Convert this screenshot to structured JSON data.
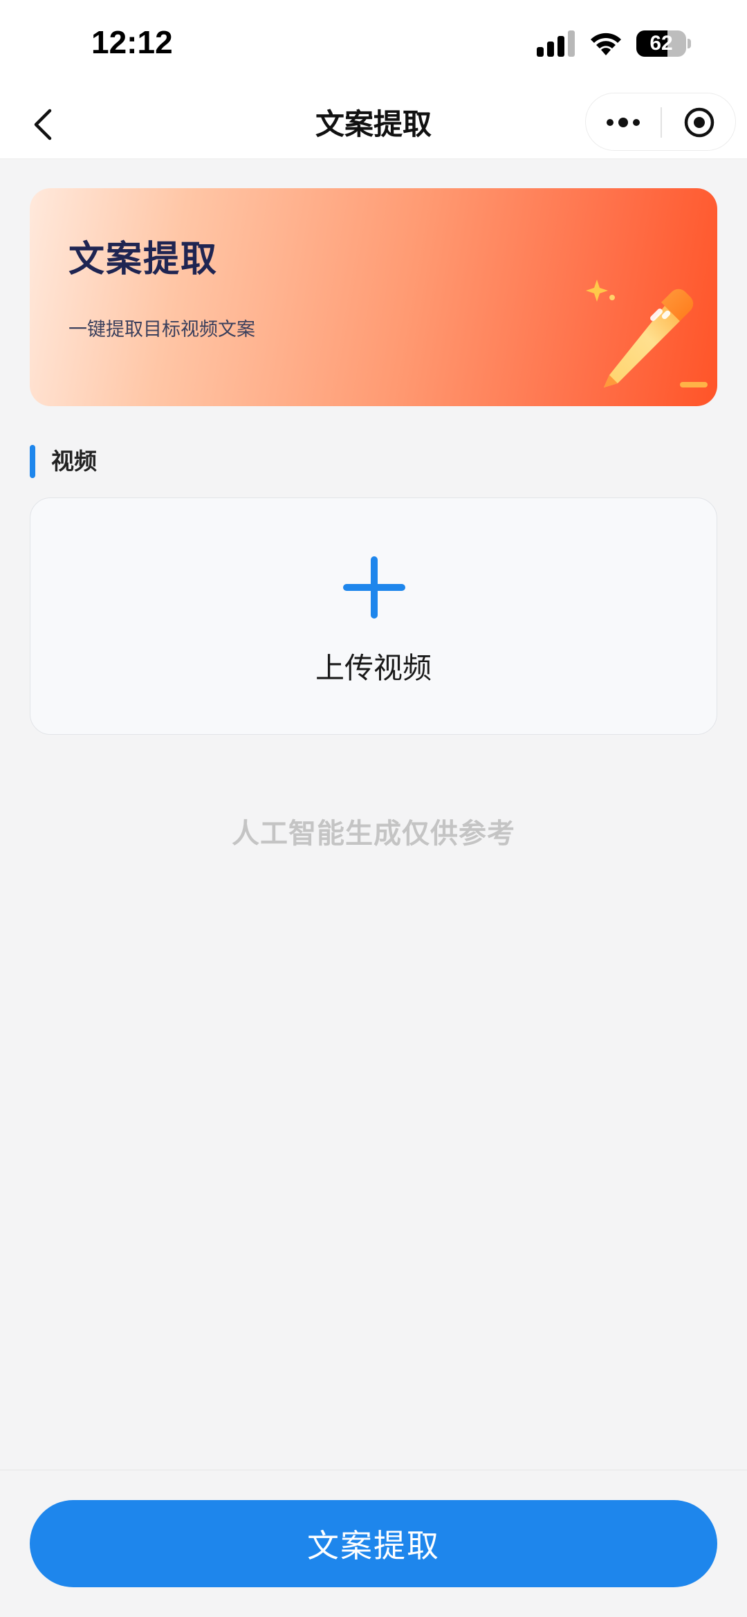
{
  "status_bar": {
    "time": "12:12",
    "battery_level": "62",
    "battery_fraction": 0.62
  },
  "nav": {
    "title": "文案提取",
    "back_icon": "chevron-left-icon",
    "more_icon": "more-dots-icon",
    "close_icon": "target-circle-icon"
  },
  "banner": {
    "title": "文案提取",
    "subtitle": "一键提取目标视频文案",
    "icon": "pencil-icon"
  },
  "section": {
    "title": "视频"
  },
  "upload": {
    "label": "上传视频",
    "icon": "plus-icon"
  },
  "disclaimer": "人工智能生成仅供参考",
  "footer": {
    "submit_label": "文案提取"
  },
  "colors": {
    "accent": "#1e86ec",
    "background": "#f4f4f5",
    "banner_start": "#ffe9dc",
    "banner_end": "#ff5428",
    "banner_title": "#1f2552"
  }
}
